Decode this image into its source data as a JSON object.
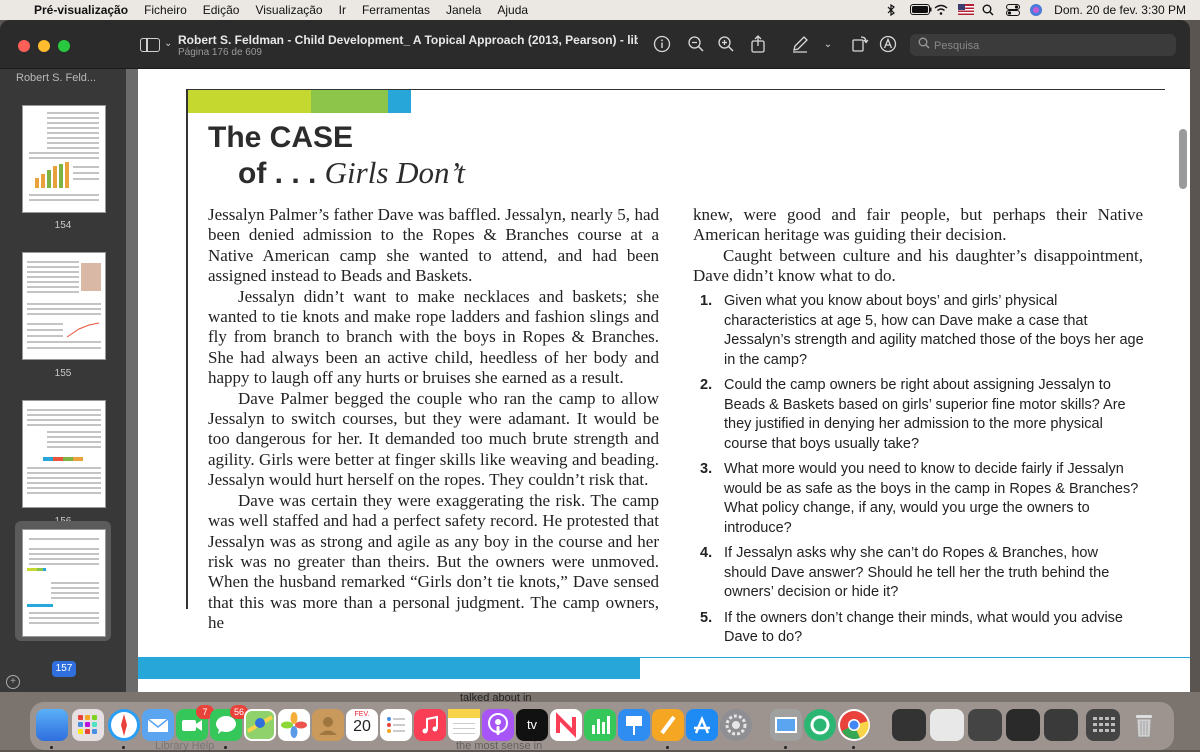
{
  "menubar": {
    "app_name": "Pré-visualização",
    "items": [
      "Ficheiro",
      "Edição",
      "Visualização",
      "Ir",
      "Ferramentas",
      "Janela",
      "Ajuda"
    ],
    "clock": "Dom. 20 de fev.  3:30 PM"
  },
  "window": {
    "title": "Robert S. Feldman - Child Development_ A Topical Approach (2013, Pearson) - lib...",
    "subtitle": "Página 176 de 609",
    "search_placeholder": "Pesquisa"
  },
  "sidebar": {
    "header": "Robert S. Feld...",
    "pages": [
      "154",
      "155",
      "156",
      "157"
    ],
    "selected_page": "157"
  },
  "document": {
    "case_title_line1": "The CASE",
    "case_title_prefix": "of . . . ",
    "case_title_italic": "Girls Don’t",
    "paragraphs_left": [
      "Jessalyn Palmer’s father Dave was baffled. Jessalyn, nearly 5, had been denied admission to the Ropes & Branches course at a Native American camp she wanted to attend, and had been assigned instead to Beads and Baskets.",
      "Jessalyn didn’t want to make necklaces and baskets; she wanted to tie knots and make rope ladders and fashion slings and fly from branch to branch with the boys in Ropes & Branches. She had always been an active child, heedless of her body and happy to laugh off any hurts or bruises she earned as a result.",
      "Dave Palmer begged the couple who ran the camp to allow Jessalyn to switch courses, but they were adamant. It would be too dangerous for her. It demanded too much brute strength and agility. Girls were better at finger skills like weaving and beading. Jessalyn would hurt herself on the ropes. They couldn’t risk that.",
      "Dave was certain they were exaggerating the risk. The camp was well staffed and had a perfect safety record. He protested that Jessalyn was as strong and agile as any boy in the course and her risk was no greater than theirs. But the owners were unmoved. When the husband remarked “Girls don’t tie knots,” Dave sensed that this was more than a personal judgment. The camp owners, he"
    ],
    "paragraphs_right": [
      "knew, were good and fair people, but perhaps their Native American heritage was guiding their decision.",
      "Caught between culture and his daughter’s disappointment, Dave didn’t know what to do."
    ],
    "questions": [
      {
        "num": "1.",
        "text": "Given what you know about boys’ and girls’ physical characteristics at age 5, how can Dave make a case that Jessalyn’s strength and agility matched those of the boys her age in the camp?"
      },
      {
        "num": "2.",
        "text": "Could the camp owners be right about assigning Jessalyn to Beads & Baskets based on girls’ superior fine motor skills? Are they justified in denying her admission to the more physical course that boys usually take?"
      },
      {
        "num": "3.",
        "text": "What more would you need to know to decide fairly if Jessalyn would be as safe as the boys in the camp in Ropes & Branches? What policy change, if any, would you urge the owners to introduce?"
      },
      {
        "num": "4.",
        "text": "If Jessalyn asks why she can’t do Ropes & Branches, how should Dave answer? Should he tell her the truth behind the owners’ decision or hide it?"
      },
      {
        "num": "5.",
        "text": "If the owners don’t change their minds, what would you advise Dave to do?"
      }
    ]
  },
  "background_peek": {
    "line1": "talked about in",
    "line2": "the most sense in",
    "line3": "Library Help"
  },
  "dock": {
    "facetime_badge": "7",
    "messages_badge": "56",
    "calendar_month": "FEV.",
    "calendar_day": "20",
    "tv_label": "tv"
  },
  "colors": {
    "accent_lime": "#c5d82f",
    "accent_green": "#8dc54a",
    "accent_blue": "#27a6d9",
    "selection": "#2f6fde"
  }
}
